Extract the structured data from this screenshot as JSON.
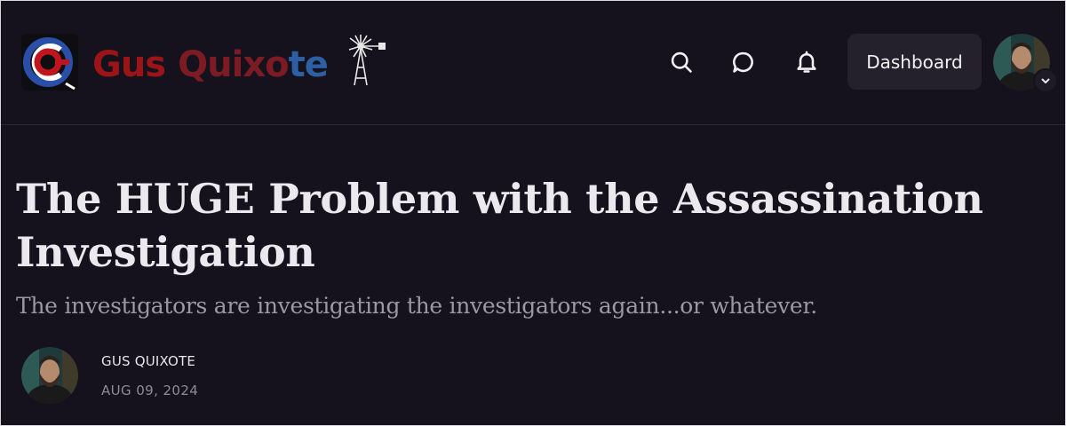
{
  "brand": {
    "wordmark_part1": "Gus",
    "wordmark_part2": "Quixo",
    "wordmark_part3": "te",
    "colors": {
      "red": "#9b1418",
      "dark_red": "#7d1b24",
      "blue": "#2c5fa3"
    }
  },
  "header": {
    "icons": [
      "search-icon",
      "chat-icon",
      "bell-icon"
    ],
    "dashboard_label": "Dashboard",
    "profile_menu_icon": "chevron-down-icon"
  },
  "article": {
    "title": "The HUGE Problem with the Assassination Investigation",
    "subtitle": "The investigators are investigating the investigators again...or whatever.",
    "author": "GUS QUIXOTE",
    "date": "AUG 09, 2024"
  },
  "theme": {
    "background": "#15121d",
    "button_bg": "#24212d",
    "text": "#ece9ef",
    "muted_text": "#9c98a3"
  }
}
